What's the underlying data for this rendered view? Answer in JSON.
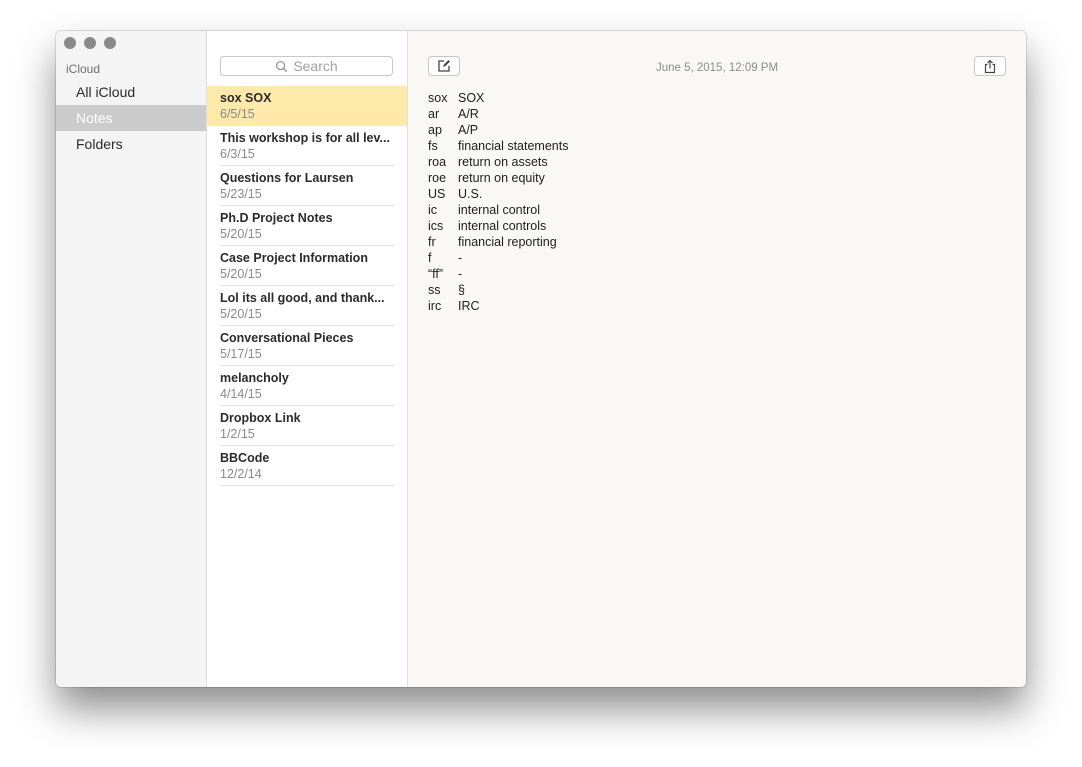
{
  "window": {
    "controls": [
      "close",
      "minimize",
      "zoom"
    ]
  },
  "sidebar": {
    "section_label": "iCloud",
    "items": [
      {
        "label": "All iCloud",
        "selected": false
      },
      {
        "label": "Notes",
        "selected": true
      },
      {
        "label": "Folders",
        "selected": false
      }
    ]
  },
  "notelist": {
    "search_placeholder": "Search",
    "notes": [
      {
        "title": "sox  SOX",
        "date": "6/5/15",
        "selected": true
      },
      {
        "title": "This workshop is for all lev...",
        "date": "6/3/15"
      },
      {
        "title": "Questions for Laursen",
        "date": "5/23/15"
      },
      {
        "title": "Ph.D Project Notes",
        "date": "5/20/15"
      },
      {
        "title": "Case Project Information",
        "date": "5/20/15"
      },
      {
        "title": "Lol its all good, and thank...",
        "date": "5/20/15"
      },
      {
        "title": "Conversational Pieces",
        "date": "5/17/15"
      },
      {
        "title": "melancholy",
        "date": "4/14/15"
      },
      {
        "title": "Dropbox Link",
        "date": "1/2/15"
      },
      {
        "title": "BBCode",
        "date": "12/2/14"
      }
    ]
  },
  "editor": {
    "timestamp": "June 5, 2015, 12:09 PM",
    "compose_icon": "compose-icon",
    "share_icon": "share-icon",
    "lines": [
      {
        "abbr": "sox",
        "text": "SOX"
      },
      {
        "abbr": "ar",
        "text": "A/R"
      },
      {
        "abbr": "ap",
        "text": "A/P"
      },
      {
        "abbr": "fs",
        "text": "financial statements"
      },
      {
        "abbr": "roa",
        "text": "return on assets"
      },
      {
        "abbr": "roe",
        "text": "return on equity"
      },
      {
        "abbr": "US",
        "text": "U.S."
      },
      {
        "abbr": "ic",
        "text": "internal control"
      },
      {
        "abbr": "ics",
        "text": "internal controls"
      },
      {
        "abbr": "fr",
        "text": "financial reporting"
      },
      {
        "abbr": "f",
        "text": "-"
      },
      {
        "abbr": "“ff”",
        "text": "-"
      },
      {
        "abbr": "ss",
        "text": "§"
      },
      {
        "abbr": "irc",
        "text": "IRC"
      }
    ]
  },
  "colors": {
    "selected_note_bg": "#fde9a9",
    "sidebar_selected_bg": "#cbcbcb",
    "editor_bg": "#f9f8f5"
  }
}
